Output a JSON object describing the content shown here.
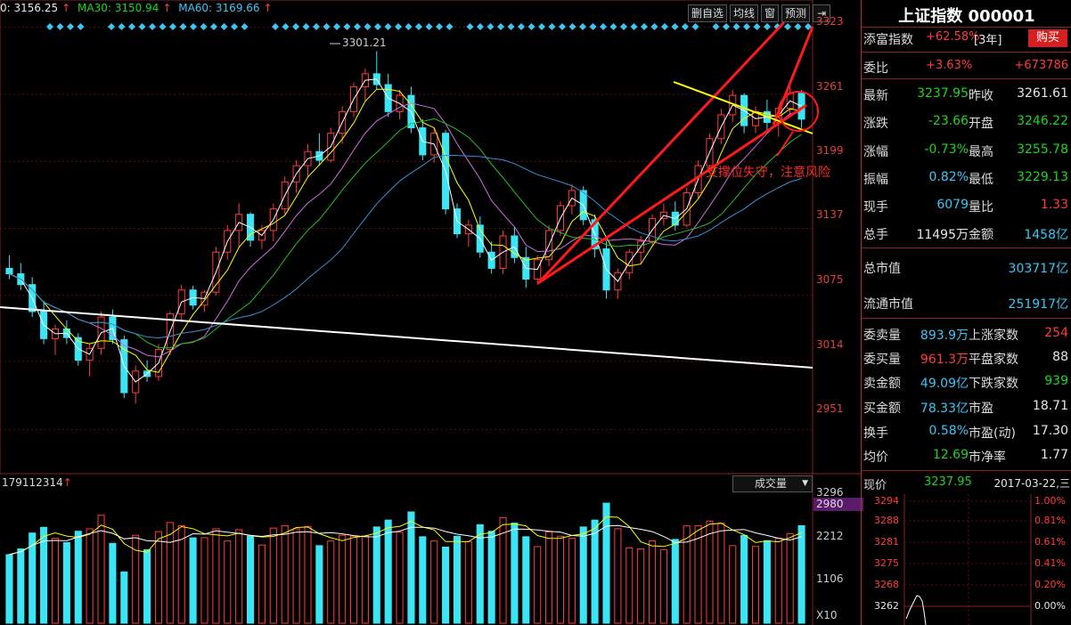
{
  "ma_bar": {
    "ma10": "0: 3156.25",
    "ma30_label": "MA30: 3150.94",
    "ma60_label": "MA60: 3169.66",
    "arrow": "↑"
  },
  "toolbar": {
    "del_fav": "删自选",
    "avg_line": "均线",
    "window": "窗",
    "forecast": "预测",
    "exit_icon": "exit-icon"
  },
  "price_axis": [
    "3323",
    "3261",
    "3199",
    "3137",
    "3075",
    "3014",
    "2951"
  ],
  "annotations": {
    "high_label": "3301.21",
    "warning_text": "支撑位失守，注意风险"
  },
  "volume": {
    "total_label": "179112314",
    "arrow": "↑",
    "dropdown_label": "成交量",
    "axis": [
      "3296",
      "2980",
      "2212",
      "1106"
    ],
    "multiplier": "X10"
  },
  "quote": {
    "title": "上证指数 000001",
    "tianfu_label": "添富指数",
    "tianfu_value": "+62.58%",
    "tianfu_period": "[3年]",
    "buy_button": "购买",
    "weibi_label": "委比",
    "weibi_pct": "+3.63%",
    "weibi_diff": "+673786",
    "latest_label": "最新",
    "latest_value": "3237.95",
    "prevclose_label": "昨收",
    "prevclose_value": "3261.61",
    "change_label": "涨跌",
    "change_value": "-23.66",
    "open_label": "开盘",
    "open_value": "3246.22",
    "changepct_label": "涨幅",
    "changepct_value": "-0.73%",
    "high_label": "最高",
    "high_value": "3255.78",
    "amplitude_label": "振幅",
    "amplitude_value": "0.82%",
    "low_label": "最低",
    "low_value": "3229.13",
    "curhand_label": "现手",
    "curhand_value": "6079",
    "volratio_label": "量比",
    "volratio_value": "1.33",
    "totalhand_label": "总手",
    "totalhand_value": "11495万",
    "amount_label": "金额",
    "amount_value": "1458亿",
    "totalcap_label": "总市值",
    "totalcap_value": "303717亿",
    "floatcap_label": "流通市值",
    "floatcap_value": "251917亿",
    "sellvol_label": "委卖量",
    "sellvol_value": "893.9万",
    "buyvol_label": "委买量",
    "buyvol_value": "961.3万",
    "sellamt_label": "卖金额",
    "sellamt_value": "49.09亿",
    "buyamt_label": "买金额",
    "buyamt_value": "78.33亿",
    "up_label": "上涨家数",
    "up_value": "254",
    "flat_label": "平盘家数",
    "flat_value": "88",
    "down_label": "下跌家数",
    "down_value": "939",
    "pe_label": "市盈",
    "pe_value": "18.71",
    "pe_dyn_label": "市盈(动)",
    "pe_dyn_value": "17.30",
    "turnover_label": "换手",
    "turnover_value": "0.58%",
    "pb_label": "市净率",
    "pb_value": "1.77",
    "avgprice_label": "均价",
    "avgprice_value": "12.69"
  },
  "intraday": {
    "price_label": "现价",
    "price_value": "3237.95",
    "date": "2017-03-22,三",
    "left_axis": [
      "3294",
      "3288",
      "3281",
      "3275",
      "3268",
      "3262"
    ],
    "right_axis": [
      "1.00%",
      "0.81%",
      "0.61%",
      "0.41%",
      "0.20%",
      "0.00%"
    ]
  },
  "colors": {
    "up": "#ff3b3b",
    "down": "#3ae6f5",
    "ma5": "#ffffff",
    "ma10": "#ffff00",
    "ma20": "#d06ee0",
    "ma30": "#25c025",
    "ma60": "#3a8fd6",
    "trend_line": "#ff1a1a",
    "support_line": "#ffff00"
  },
  "chart_data": {
    "type": "candlestick",
    "title": "上证指数 000001",
    "ylim": [
      2920,
      3340
    ],
    "candles": [
      [
        3100,
        3112,
        3090,
        3095
      ],
      [
        3095,
        3105,
        3080,
        3085
      ],
      [
        3085,
        3092,
        3055,
        3060
      ],
      [
        3060,
        3070,
        3030,
        3035
      ],
      [
        3035,
        3048,
        3020,
        3044
      ],
      [
        3044,
        3052,
        3030,
        3036
      ],
      [
        3036,
        3040,
        3010,
        3015
      ],
      [
        3015,
        3030,
        3000,
        3026
      ],
      [
        3026,
        3060,
        3020,
        3055
      ],
      [
        3055,
        3062,
        3030,
        3034
      ],
      [
        3034,
        3038,
        2980,
        2985
      ],
      [
        2985,
        3010,
        2975,
        3005
      ],
      [
        3005,
        3015,
        2995,
        3000
      ],
      [
        3000,
        3030,
        2996,
        3025
      ],
      [
        3025,
        3060,
        3020,
        3058
      ],
      [
        3058,
        3085,
        3050,
        3080
      ],
      [
        3080,
        3084,
        3062,
        3066
      ],
      [
        3066,
        3080,
        3060,
        3078
      ],
      [
        3078,
        3120,
        3075,
        3115
      ],
      [
        3115,
        3140,
        3108,
        3135
      ],
      [
        3135,
        3160,
        3120,
        3150
      ],
      [
        3150,
        3152,
        3120,
        3126
      ],
      [
        3126,
        3140,
        3118,
        3135
      ],
      [
        3135,
        3160,
        3125,
        3155
      ],
      [
        3155,
        3185,
        3150,
        3180
      ],
      [
        3180,
        3200,
        3170,
        3195
      ],
      [
        3195,
        3215,
        3185,
        3208
      ],
      [
        3208,
        3225,
        3195,
        3200
      ],
      [
        3200,
        3230,
        3198,
        3225
      ],
      [
        3225,
        3250,
        3215,
        3245
      ],
      [
        3245,
        3272,
        3240,
        3268
      ],
      [
        3268,
        3285,
        3255,
        3280
      ],
      [
        3280,
        3301,
        3265,
        3270
      ],
      [
        3270,
        3280,
        3240,
        3245
      ],
      [
        3245,
        3265,
        3238,
        3260
      ],
      [
        3260,
        3268,
        3225,
        3230
      ],
      [
        3230,
        3238,
        3200,
        3205
      ],
      [
        3205,
        3230,
        3198,
        3225
      ],
      [
        3225,
        3228,
        3150,
        3155
      ],
      [
        3155,
        3160,
        3128,
        3132
      ],
      [
        3132,
        3145,
        3120,
        3140
      ],
      [
        3140,
        3148,
        3110,
        3115
      ],
      [
        3115,
        3125,
        3095,
        3100
      ],
      [
        3100,
        3135,
        3095,
        3130
      ],
      [
        3130,
        3138,
        3105,
        3110
      ],
      [
        3110,
        3120,
        3082,
        3090
      ],
      [
        3090,
        3112,
        3085,
        3108
      ],
      [
        3108,
        3140,
        3102,
        3135
      ],
      [
        3135,
        3162,
        3130,
        3158
      ],
      [
        3158,
        3178,
        3150,
        3172
      ],
      [
        3172,
        3176,
        3140,
        3145
      ],
      [
        3145,
        3150,
        3110,
        3118
      ],
      [
        3118,
        3125,
        3072,
        3080
      ],
      [
        3080,
        3100,
        3072,
        3096
      ],
      [
        3096,
        3118,
        3090,
        3115
      ],
      [
        3115,
        3130,
        3105,
        3125
      ],
      [
        3125,
        3150,
        3120,
        3146
      ],
      [
        3146,
        3160,
        3140,
        3152
      ],
      [
        3152,
        3162,
        3135,
        3140
      ],
      [
        3140,
        3175,
        3138,
        3170
      ],
      [
        3170,
        3200,
        3165,
        3195
      ],
      [
        3195,
        3225,
        3188,
        3220
      ],
      [
        3220,
        3248,
        3215,
        3242
      ],
      [
        3242,
        3265,
        3235,
        3260
      ],
      [
        3260,
        3262,
        3225,
        3232
      ],
      [
        3232,
        3250,
        3225,
        3245
      ],
      [
        3245,
        3256,
        3228,
        3235
      ],
      [
        3235,
        3250,
        3222,
        3248
      ],
      [
        3248,
        3270,
        3240,
        3262
      ],
      [
        3262,
        3265,
        3230,
        3238
      ]
    ],
    "volume_axis": [
      1106,
      2212,
      3296
    ]
  }
}
